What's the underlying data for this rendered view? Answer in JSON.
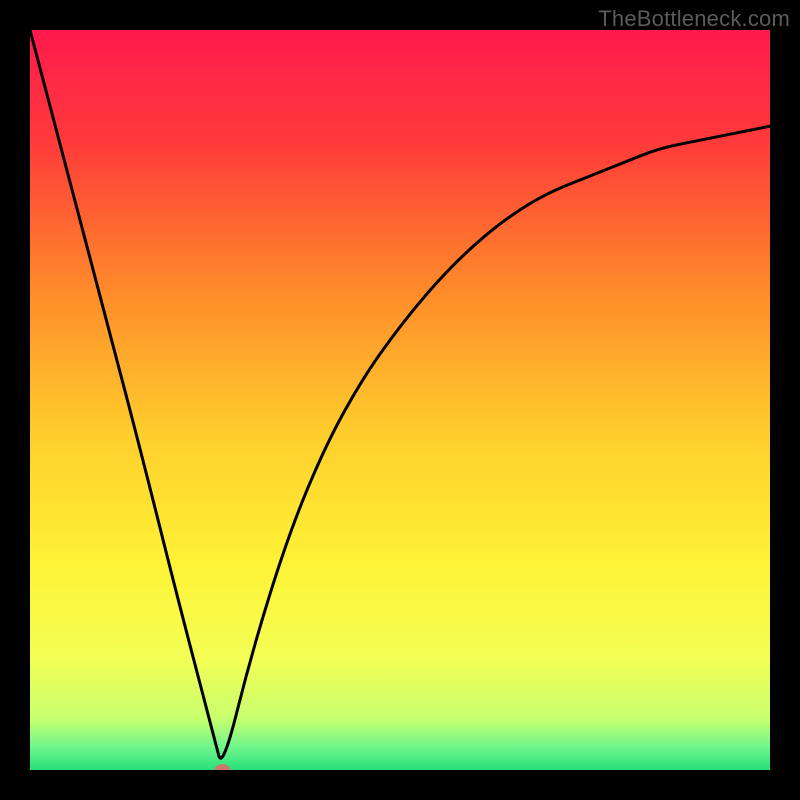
{
  "watermark": "TheBottleneck.com",
  "chart_data": {
    "type": "line",
    "title": "",
    "xlabel": "",
    "ylabel": "",
    "xlim": [
      0,
      100
    ],
    "ylim": [
      0,
      100
    ],
    "grid": false,
    "marker": {
      "x": 26,
      "y": 0,
      "color": "#c97a6b"
    },
    "series": [
      {
        "name": "curve",
        "color": "#000000",
        "x": [
          0,
          5,
          10,
          15,
          20,
          25,
          26,
          30,
          35,
          40,
          45,
          50,
          55,
          60,
          65,
          70,
          75,
          80,
          85,
          90,
          95,
          100
        ],
        "values": [
          100,
          81,
          62,
          43,
          23,
          4,
          0,
          16,
          32,
          44,
          53,
          60,
          66,
          71,
          75,
          78,
          80,
          82,
          84,
          85,
          86,
          87
        ]
      }
    ],
    "gradient_stops": [
      {
        "offset": 0.0,
        "color": "#ff1a4e"
      },
      {
        "offset": 0.15,
        "color": "#ff3a3a"
      },
      {
        "offset": 0.35,
        "color": "#ff8a2a"
      },
      {
        "offset": 0.55,
        "color": "#ffcf2d"
      },
      {
        "offset": 0.72,
        "color": "#fff236"
      },
      {
        "offset": 0.85,
        "color": "#f3ff55"
      },
      {
        "offset": 0.93,
        "color": "#c8ff6e"
      },
      {
        "offset": 0.97,
        "color": "#6ef58b"
      },
      {
        "offset": 1.0,
        "color": "#28e07a"
      }
    ]
  }
}
